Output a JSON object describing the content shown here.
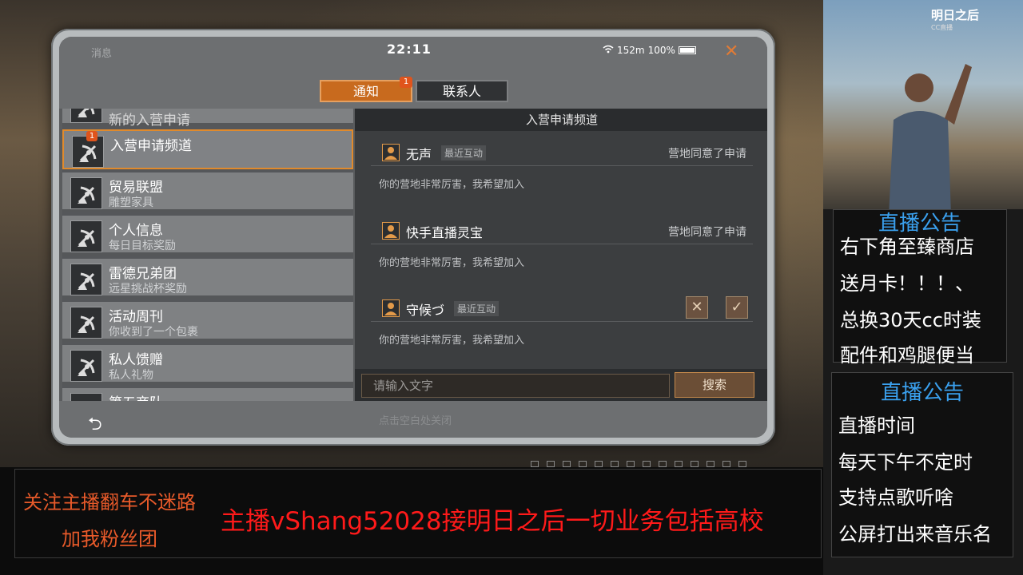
{
  "status_bar": {
    "app_label": "消息",
    "time": "22:11",
    "network": "152m",
    "battery": "100%"
  },
  "tabs": [
    {
      "label": "通知",
      "badge": "1",
      "active": true
    },
    {
      "label": "联系人",
      "active": false
    }
  ],
  "list": [
    {
      "title": "新的入营申请",
      "sub": ""
    },
    {
      "title": "入营申请频道",
      "sub": "",
      "badge": "1",
      "active": true
    },
    {
      "title": "贸易联盟",
      "sub": "雕塑家具"
    },
    {
      "title": "个人信息",
      "sub": "每日目标奖励"
    },
    {
      "title": "雷德兄弟团",
      "sub": "远星挑战杯奖励"
    },
    {
      "title": "活动周刊",
      "sub": "你收到了一个包裹"
    },
    {
      "title": "私人馈赠",
      "sub": "私人礼物"
    },
    {
      "title": "第五商队",
      "sub": ""
    }
  ],
  "panel": {
    "header": "入营申请频道",
    "messages": [
      {
        "name": "无声",
        "tag": "最近互动",
        "status": "营地同意了申请",
        "text": "你的营地非常厉害，我希望加入"
      },
      {
        "name": "快手直播灵宝",
        "tag": "",
        "status": "营地同意了申请",
        "text": "你的营地非常厉害，我希望加入"
      },
      {
        "name": "守候づ",
        "tag": "最近互动",
        "status": "",
        "text": "你的营地非常厉害，我希望加入"
      }
    ],
    "search_placeholder": "请输入文字",
    "search_button": "搜索"
  },
  "bottom_hint": "点击空白处关闭",
  "overlay": {
    "logo": "明日之后",
    "logo_sub": "CC直播",
    "notice1": {
      "title": "直播公告",
      "lines": [
        "右下角至臻商店",
        "送月卡！！！、",
        "总换30天cc时装",
        "配件和鸡腿便当"
      ]
    },
    "notice2": {
      "title": "直播公告",
      "lines": [
        "直播时间",
        "每天下午不定时",
        "支持点歌听啥",
        "公屏打出来音乐名"
      ]
    },
    "follow": [
      "关注主播翻车不迷路",
      "加我粉丝团"
    ],
    "banner": "主播vShang52028接明日之后一切业务包括高校"
  },
  "colors": {
    "accent": "#c86a1e",
    "notice_blue": "#3aa0ee",
    "banner_red": "#ff1a1a"
  }
}
